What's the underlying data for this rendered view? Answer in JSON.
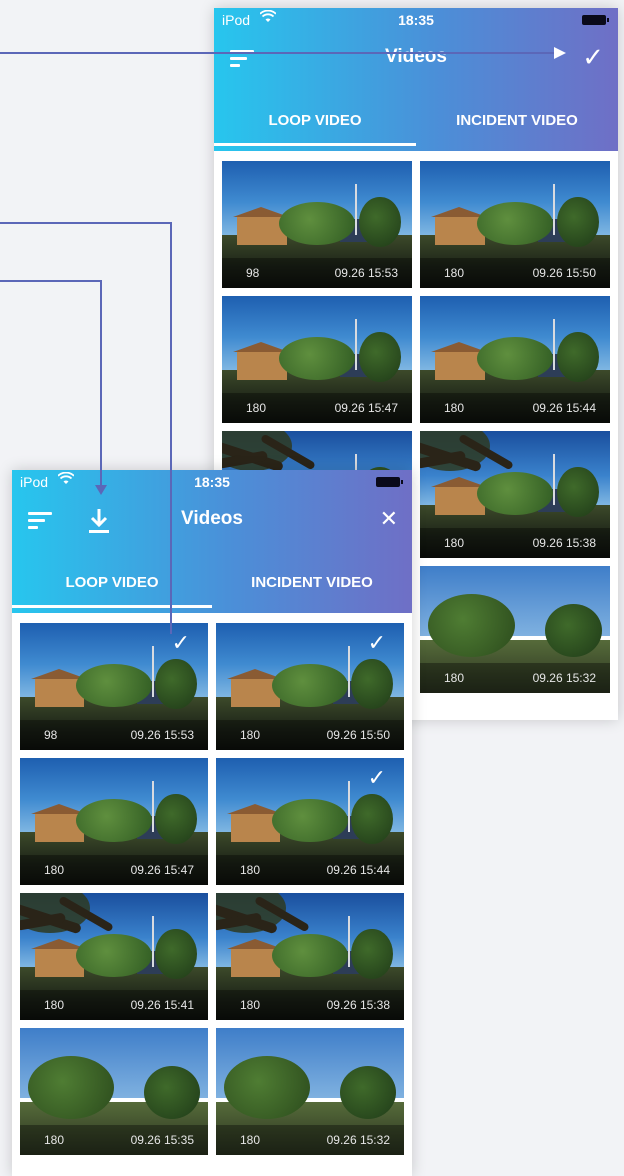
{
  "back_phone": {
    "status": {
      "carrier": "iPod",
      "time": "18:35"
    },
    "title": "Videos",
    "tabs": [
      {
        "label": "LOOP VIDEO",
        "active": true
      },
      {
        "label": "INCIDENT VIDEO",
        "active": false
      }
    ],
    "confirm_icon": "✓",
    "videos": [
      {
        "duration": "98",
        "timestamp": "09.26 15:53",
        "scene": "street"
      },
      {
        "duration": "180",
        "timestamp": "09.26 15:50",
        "scene": "street"
      },
      {
        "duration": "180",
        "timestamp": "09.26 15:47",
        "scene": "street"
      },
      {
        "duration": "180",
        "timestamp": "09.26 15:44",
        "scene": "street"
      },
      {
        "duration": "",
        "timestamp": "",
        "scene": "branches"
      },
      {
        "duration": "180",
        "timestamp": "09.26 15:38",
        "scene": "branches"
      },
      {
        "duration": "",
        "timestamp": "",
        "scene": "park"
      },
      {
        "duration": "180",
        "timestamp": "09.26 15:32",
        "scene": "park"
      }
    ]
  },
  "front_phone": {
    "status": {
      "carrier": "iPod",
      "time": "18:35"
    },
    "title": "Videos",
    "tabs": [
      {
        "label": "LOOP VIDEO",
        "active": true
      },
      {
        "label": "INCIDENT VIDEO",
        "active": false
      }
    ],
    "close_icon": "✕",
    "videos": [
      {
        "duration": "98",
        "timestamp": "09.26 15:53",
        "selected": true,
        "scene": "street"
      },
      {
        "duration": "180",
        "timestamp": "09.26 15:50",
        "selected": true,
        "scene": "street"
      },
      {
        "duration": "180",
        "timestamp": "09.26 15:47",
        "selected": false,
        "scene": "street"
      },
      {
        "duration": "180",
        "timestamp": "09.26 15:44",
        "selected": true,
        "scene": "street"
      },
      {
        "duration": "180",
        "timestamp": "09.26 15:41",
        "selected": false,
        "scene": "branches"
      },
      {
        "duration": "180",
        "timestamp": "09.26 15:38",
        "selected": false,
        "scene": "branches"
      },
      {
        "duration": "180",
        "timestamp": "09.26 15:35",
        "selected": false,
        "scene": "park"
      },
      {
        "duration": "180",
        "timestamp": "09.26 15:32",
        "selected": false,
        "scene": "park"
      }
    ]
  },
  "colors": {
    "header_gradient_start": "#27c6ee",
    "header_gradient_end": "#6f6fc6",
    "connector": "#5b67b8"
  }
}
